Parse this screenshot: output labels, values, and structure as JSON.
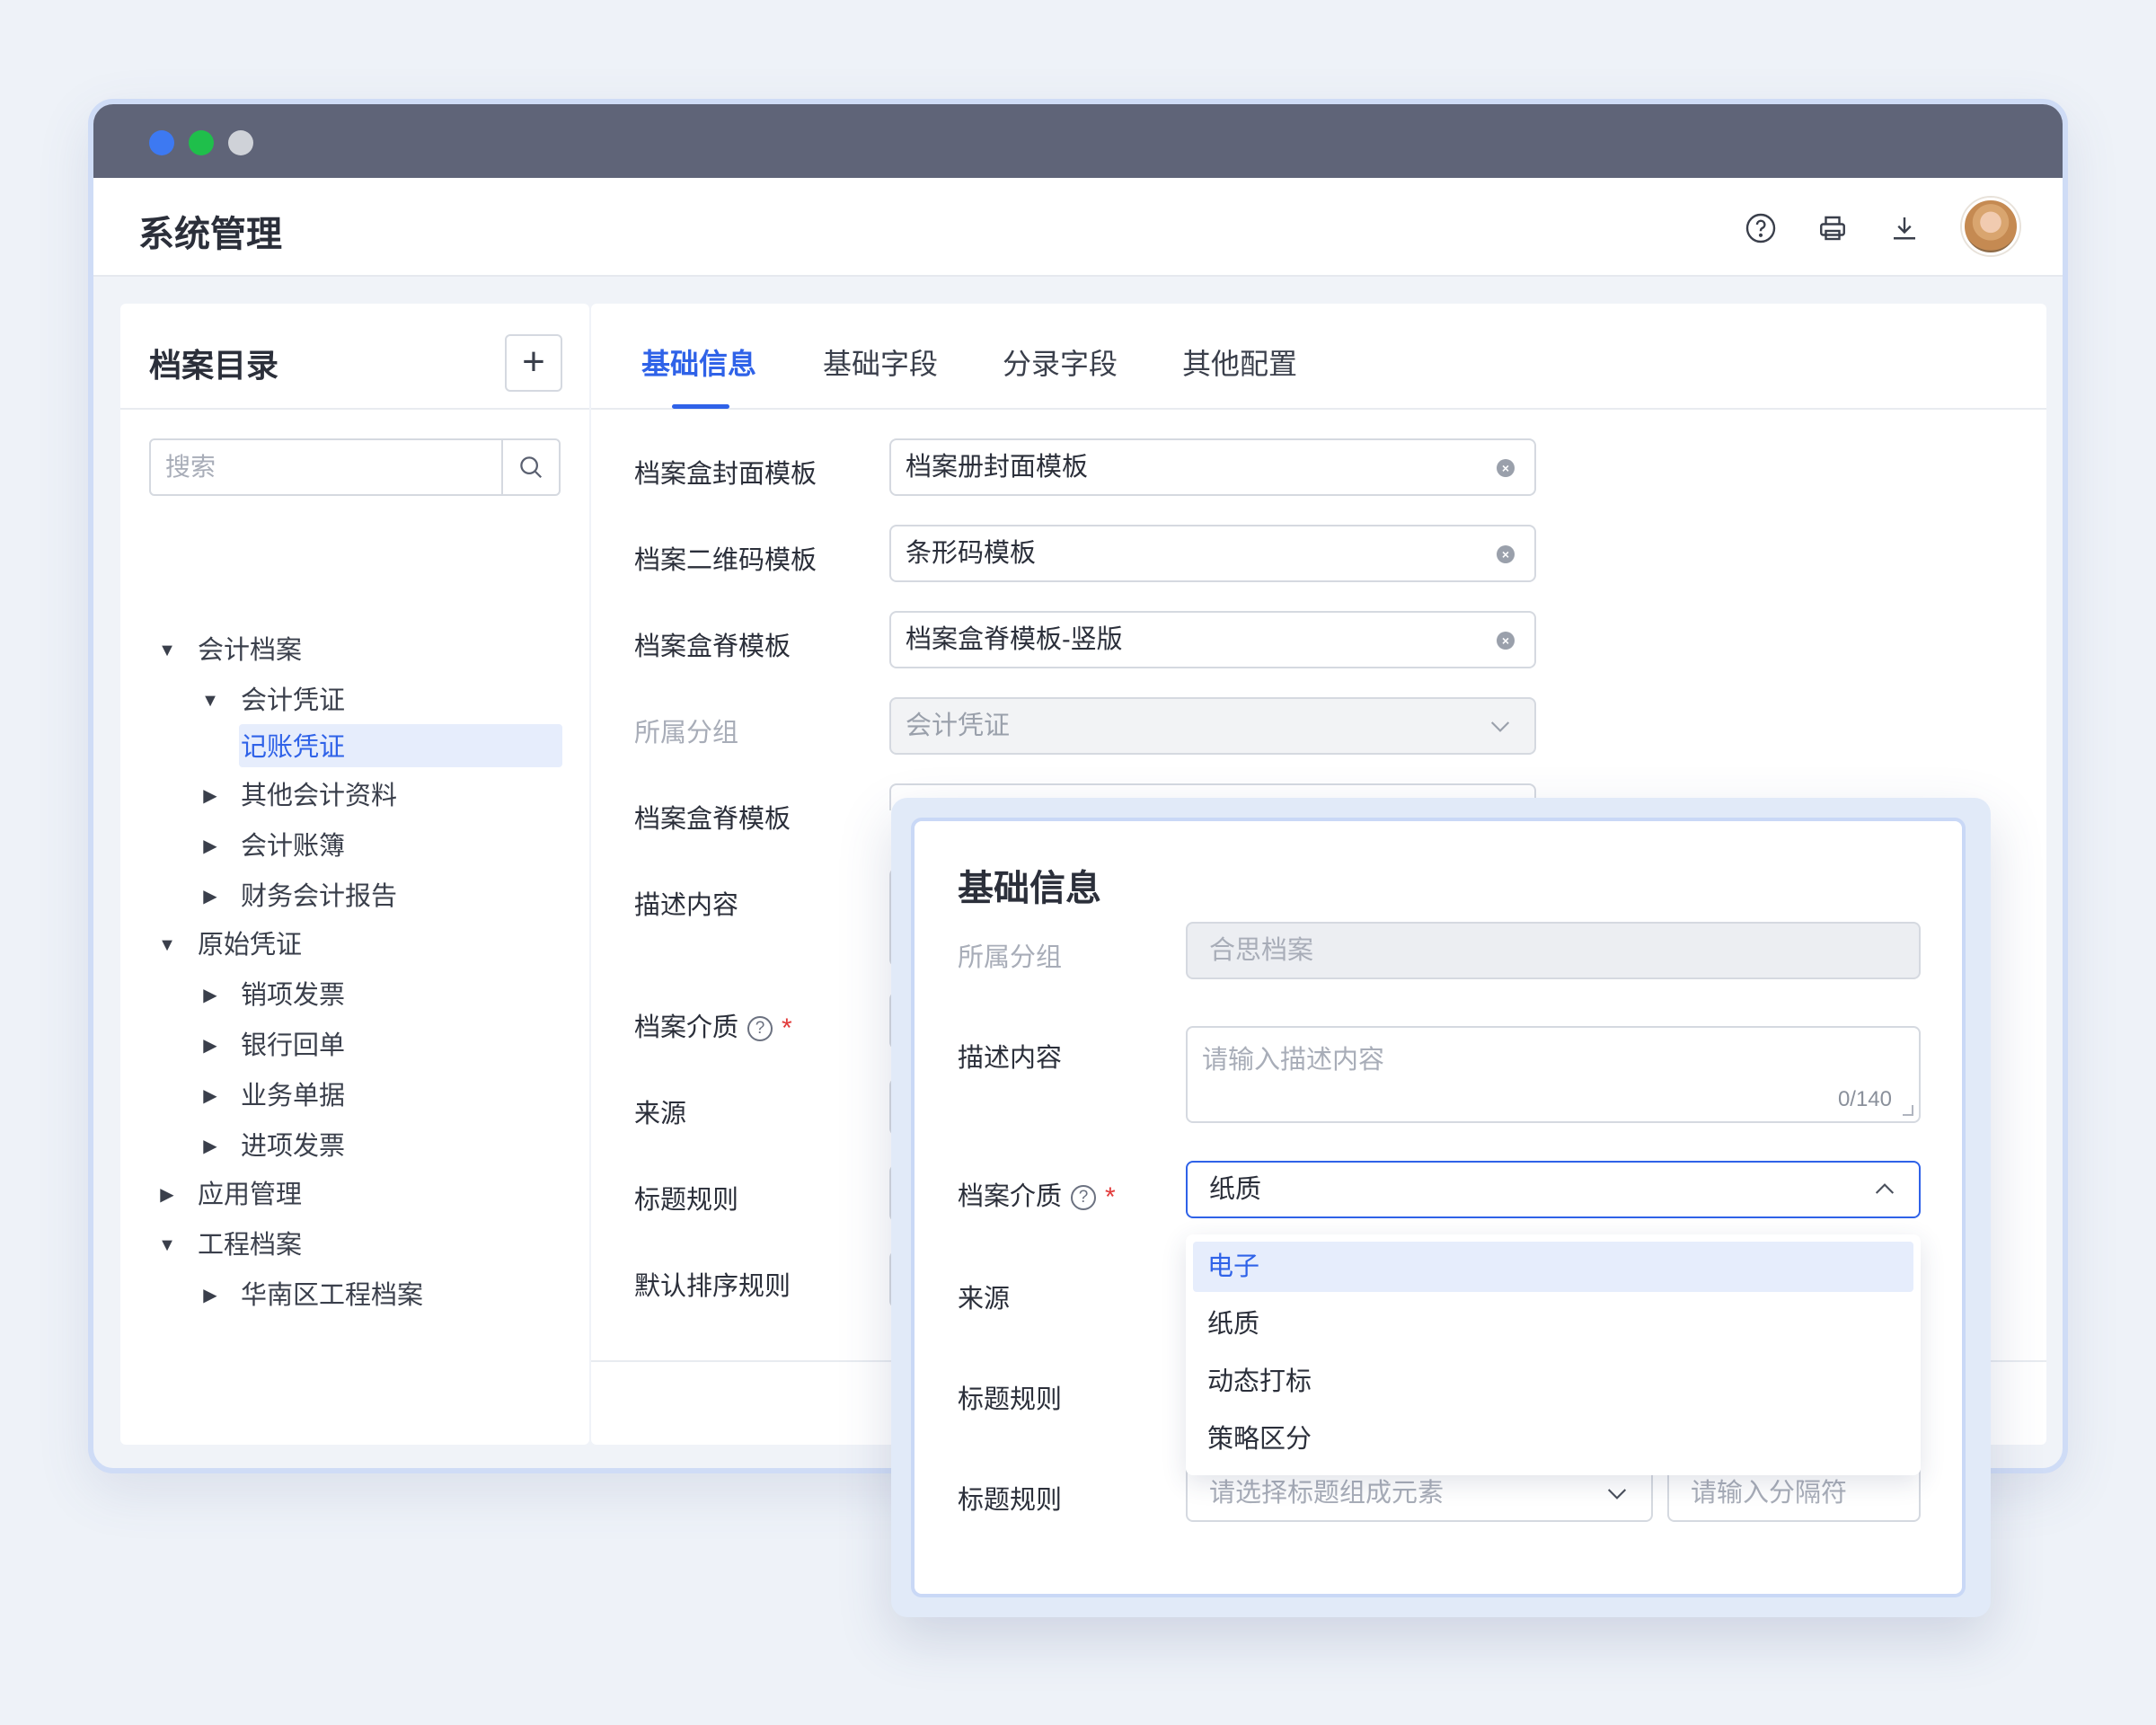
{
  "app": {
    "title": "系统管理"
  },
  "header_icons": [
    "help-icon",
    "print-icon",
    "download-icon"
  ],
  "sidebar": {
    "title": "档案目录",
    "add_label": "+",
    "search_placeholder": "搜索",
    "tree": [
      {
        "label": "会计档案",
        "expanded": true
      },
      {
        "label": "会计凭证",
        "expanded": true
      },
      {
        "label": "记账凭证",
        "selected": true
      },
      {
        "label": "其他会计资料",
        "expanded": false
      },
      {
        "label": "会计账簿",
        "expanded": false
      },
      {
        "label": "财务会计报告",
        "expanded": false
      },
      {
        "label": "原始凭证",
        "expanded": true
      },
      {
        "label": "销项发票",
        "expanded": false
      },
      {
        "label": "银行回单",
        "expanded": false
      },
      {
        "label": "业务单据",
        "expanded": false
      },
      {
        "label": "进项发票",
        "expanded": false
      },
      {
        "label": "应用管理",
        "expanded": false
      },
      {
        "label": "工程档案",
        "expanded": true
      },
      {
        "label": "华南区工程档案",
        "expanded": false
      }
    ]
  },
  "tabs": [
    {
      "label": "基础信息",
      "active": true
    },
    {
      "label": "基础字段"
    },
    {
      "label": "分录字段"
    },
    {
      "label": "其他配置"
    }
  ],
  "form": {
    "cover_label": "档案盒封面模板",
    "cover_value": "档案册封面模板",
    "qr_label": "档案二维码模板",
    "qr_value": "条形码模板",
    "spine_label": "档案盒脊模板",
    "spine_value": "档案盒脊模板-竖版",
    "group_label": "所属分组",
    "group_value": "会计凭证",
    "spine2_label": "档案盒脊模板",
    "desc_label": "描述内容",
    "medium_label": "档案介质",
    "source_label": "来源",
    "title_rule_label": "标题规则",
    "sort_rule_label": "默认排序规则"
  },
  "popup": {
    "title": "基础信息",
    "group_label": "所属分组",
    "group_value": "合思档案",
    "desc_label": "描述内容",
    "desc_placeholder": "请输入描述内容",
    "desc_count": "0/140",
    "medium_label": "档案介质",
    "medium_value": "纸质",
    "source_label": "来源",
    "title_rule_label": "标题规则",
    "title_rule2_label": "标题规则",
    "title_elements_placeholder": "请选择标题组成元素",
    "separator_placeholder": "请输入分隔符",
    "options": [
      {
        "label": "电子",
        "highlighted": true
      },
      {
        "label": "纸质"
      },
      {
        "label": "动态打标"
      },
      {
        "label": "策略区分"
      }
    ]
  },
  "colors": {
    "accent": "#2f62e8",
    "titlebar": "#5f6478",
    "required": "#e23b3b"
  }
}
